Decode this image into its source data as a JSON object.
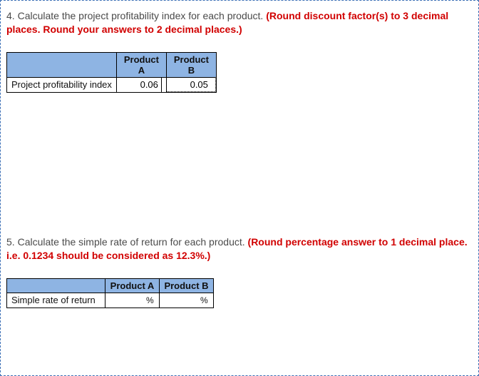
{
  "q4": {
    "number": "4.",
    "prompt": "Calculate the project profitability index for each product.",
    "instruction": "(Round discount factor(s) to 3 decimal places. Round your answers to 2 decimal places.)",
    "table": {
      "row_label": "Project profitability index",
      "col_a": "Product A",
      "col_b": "Product B",
      "val_a": "0.06",
      "val_b": "0.05"
    }
  },
  "q5": {
    "number": "5.",
    "prompt": "Calculate the simple rate of return for each product.",
    "instruction": "(Round percentage answer to 1 decimal place. i.e. 0.1234 should be considered as 12.3%.)",
    "table": {
      "row_label": "Simple rate of return",
      "col_a": "Product A",
      "col_b": "Product B",
      "val_a": "",
      "val_b": "",
      "unit": "%"
    }
  }
}
